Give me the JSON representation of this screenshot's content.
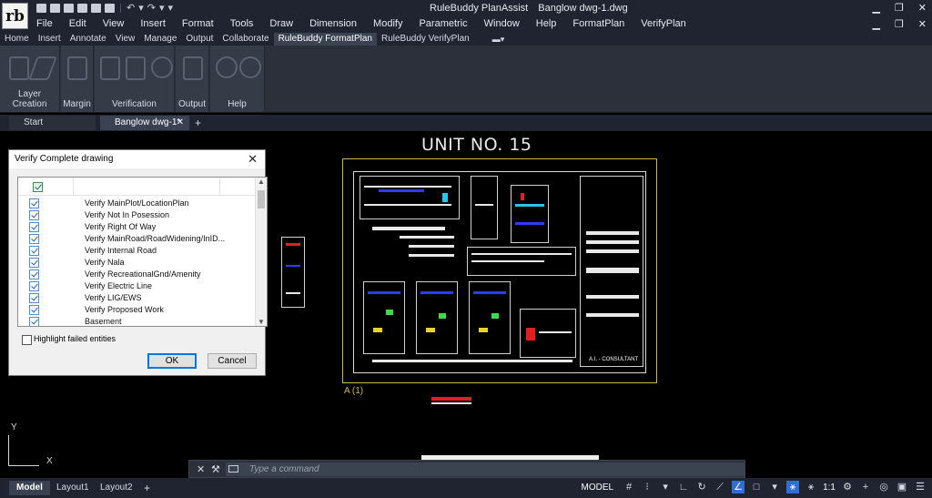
{
  "app": {
    "logo": "rb",
    "app_name": "RuleBuddy PlanAssist",
    "file_name": "Banglow dwg-1.dwg"
  },
  "menu": [
    "File",
    "Edit",
    "View",
    "Insert",
    "Format",
    "Tools",
    "Draw",
    "Dimension",
    "Modify",
    "Parametric",
    "Window",
    "Help",
    "FormatPlan",
    "VerifyPlan"
  ],
  "ribbon_tabs": [
    "Home",
    "Insert",
    "Annotate",
    "View",
    "Manage",
    "Output",
    "Collaborate",
    "RuleBuddy FormatPlan",
    "RuleBuddy VerifyPlan"
  ],
  "active_ribbon_tab": "RuleBuddy FormatPlan",
  "ribbon_panels": [
    "Layer Creation",
    "Margin",
    "Verification",
    "Output",
    "Help"
  ],
  "doc_tabs": {
    "start": "Start",
    "file": "Banglow dwg-1*",
    "close": "✕",
    "add": "+"
  },
  "canvas": {
    "unit_title": "UNIT NO. 15",
    "sheet_label": "A (1)",
    "consultant": "A.I. - CONSULTANT",
    "ucs_x": "X",
    "ucs_y": "Y"
  },
  "dialog": {
    "title": "Verify Complete drawing",
    "items": [
      {
        "label": "Verify MainPlot/LocationPlan",
        "checked": true
      },
      {
        "label": "Verify Not In Posession",
        "checked": true
      },
      {
        "label": "Verify Right Of Way",
        "checked": true
      },
      {
        "label": "Verify MainRoad/RoadWidening/InID...",
        "checked": true
      },
      {
        "label": "Verify Internal Road",
        "checked": true
      },
      {
        "label": "Verify Nala",
        "checked": true
      },
      {
        "label": "Verify RecreationalGnd/Amenity",
        "checked": true
      },
      {
        "label": "Verify Electric Line",
        "checked": true
      },
      {
        "label": "Verify LIG/EWS",
        "checked": true
      },
      {
        "label": "Verify Proposed Work",
        "checked": true
      },
      {
        "label": "Basement",
        "checked": true
      }
    ],
    "highlight_label": "Highlight failed entities",
    "highlight_checked": false,
    "ok_label": "OK",
    "cancel_label": "Cancel"
  },
  "command_line": {
    "placeholder": "Type a command"
  },
  "status": {
    "layout_tabs": [
      "Model",
      "Layout1",
      "Layout2"
    ],
    "add": "+",
    "model_label": "MODEL",
    "scale": "1:1"
  },
  "colors": {
    "accent": "#2f6fd0",
    "sheet_border": "#c9b84a",
    "active_tab": "#3b4352"
  }
}
